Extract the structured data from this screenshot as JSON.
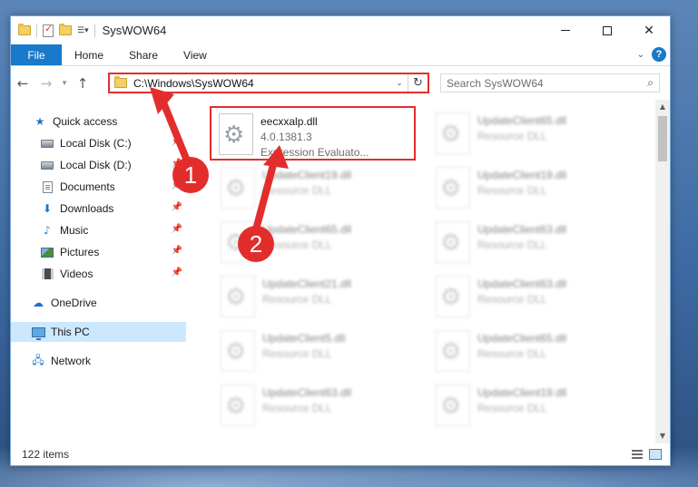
{
  "window": {
    "title": "SysWOW64",
    "icons": [
      "folder-icon",
      "properties-icon",
      "new-folder-icon",
      "customize-icon"
    ]
  },
  "ribbon": {
    "tabs": [
      {
        "label": "File",
        "active": true
      },
      {
        "label": "Home"
      },
      {
        "label": "Share"
      },
      {
        "label": "View"
      }
    ],
    "help_label": "?"
  },
  "nav": {
    "address": "C:\\Windows\\SysWOW64",
    "search_placeholder": "Search SysWOW64"
  },
  "sidebar": {
    "items": [
      {
        "label": "Quick access",
        "icon": "star-icon",
        "pinned": false
      },
      {
        "label": "Local Disk (C:)",
        "icon": "disk-icon",
        "pinned": true
      },
      {
        "label": "Local Disk (D:)",
        "icon": "disk-icon",
        "pinned": true
      },
      {
        "label": "Documents",
        "icon": "documents-icon",
        "pinned": true
      },
      {
        "label": "Downloads",
        "icon": "downloads-icon",
        "pinned": true
      },
      {
        "label": "Music",
        "icon": "music-icon",
        "pinned": true
      },
      {
        "label": "Pictures",
        "icon": "pictures-icon",
        "pinned": true
      },
      {
        "label": "Videos",
        "icon": "videos-icon",
        "pinned": true
      },
      {
        "label": "OneDrive",
        "icon": "onedrive-icon",
        "pinned": false
      },
      {
        "label": "This PC",
        "icon": "this-pc-icon",
        "pinned": false,
        "selected": true
      },
      {
        "label": "Network",
        "icon": "network-icon",
        "pinned": false
      }
    ]
  },
  "files": [
    {
      "name": "eecxxalp.dll",
      "line2": "4.0.1381.3",
      "line3": "Expression Evaluato...",
      "highlighted": true
    },
    {
      "name": "UpdateClient65.dll",
      "line2": "Resource DLL",
      "blurred": true
    },
    {
      "name": "UpdateClient19.dll",
      "line2": "Resource DLL",
      "blurred": true
    },
    {
      "name": "UpdateClient19.dll",
      "line2": "Resource DLL",
      "blurred": true
    },
    {
      "name": "UpdateClient65.dll",
      "line2": "Resource DLL",
      "blurred": true
    },
    {
      "name": "UpdateClient63.dll",
      "line2": "Resource DLL",
      "blurred": true
    },
    {
      "name": "UpdateClient21.dll",
      "line2": "Resource DLL",
      "blurred": true
    },
    {
      "name": "UpdateClient63.dll",
      "line2": "Resource DLL",
      "blurred": true
    },
    {
      "name": "UpdateClient5.dll",
      "line2": "Resource DLL",
      "blurred": true
    },
    {
      "name": "UpdateClient65.dll",
      "line2": "Resource DLL",
      "blurred": true
    },
    {
      "name": "UpdateClient63.dll",
      "line2": "Resource DLL",
      "blurred": true
    },
    {
      "name": "UpdateClient19.dll",
      "line2": "Resource DLL",
      "blurred": true
    }
  ],
  "status": {
    "item_count": "122 items"
  },
  "annotations": [
    {
      "label": "1",
      "color": "#e32d2d"
    },
    {
      "label": "2",
      "color": "#e32d2d"
    }
  ],
  "colors": {
    "accent": "#1979ca",
    "highlight": "#e32d2d",
    "selected_bg": "#cce8ff"
  }
}
